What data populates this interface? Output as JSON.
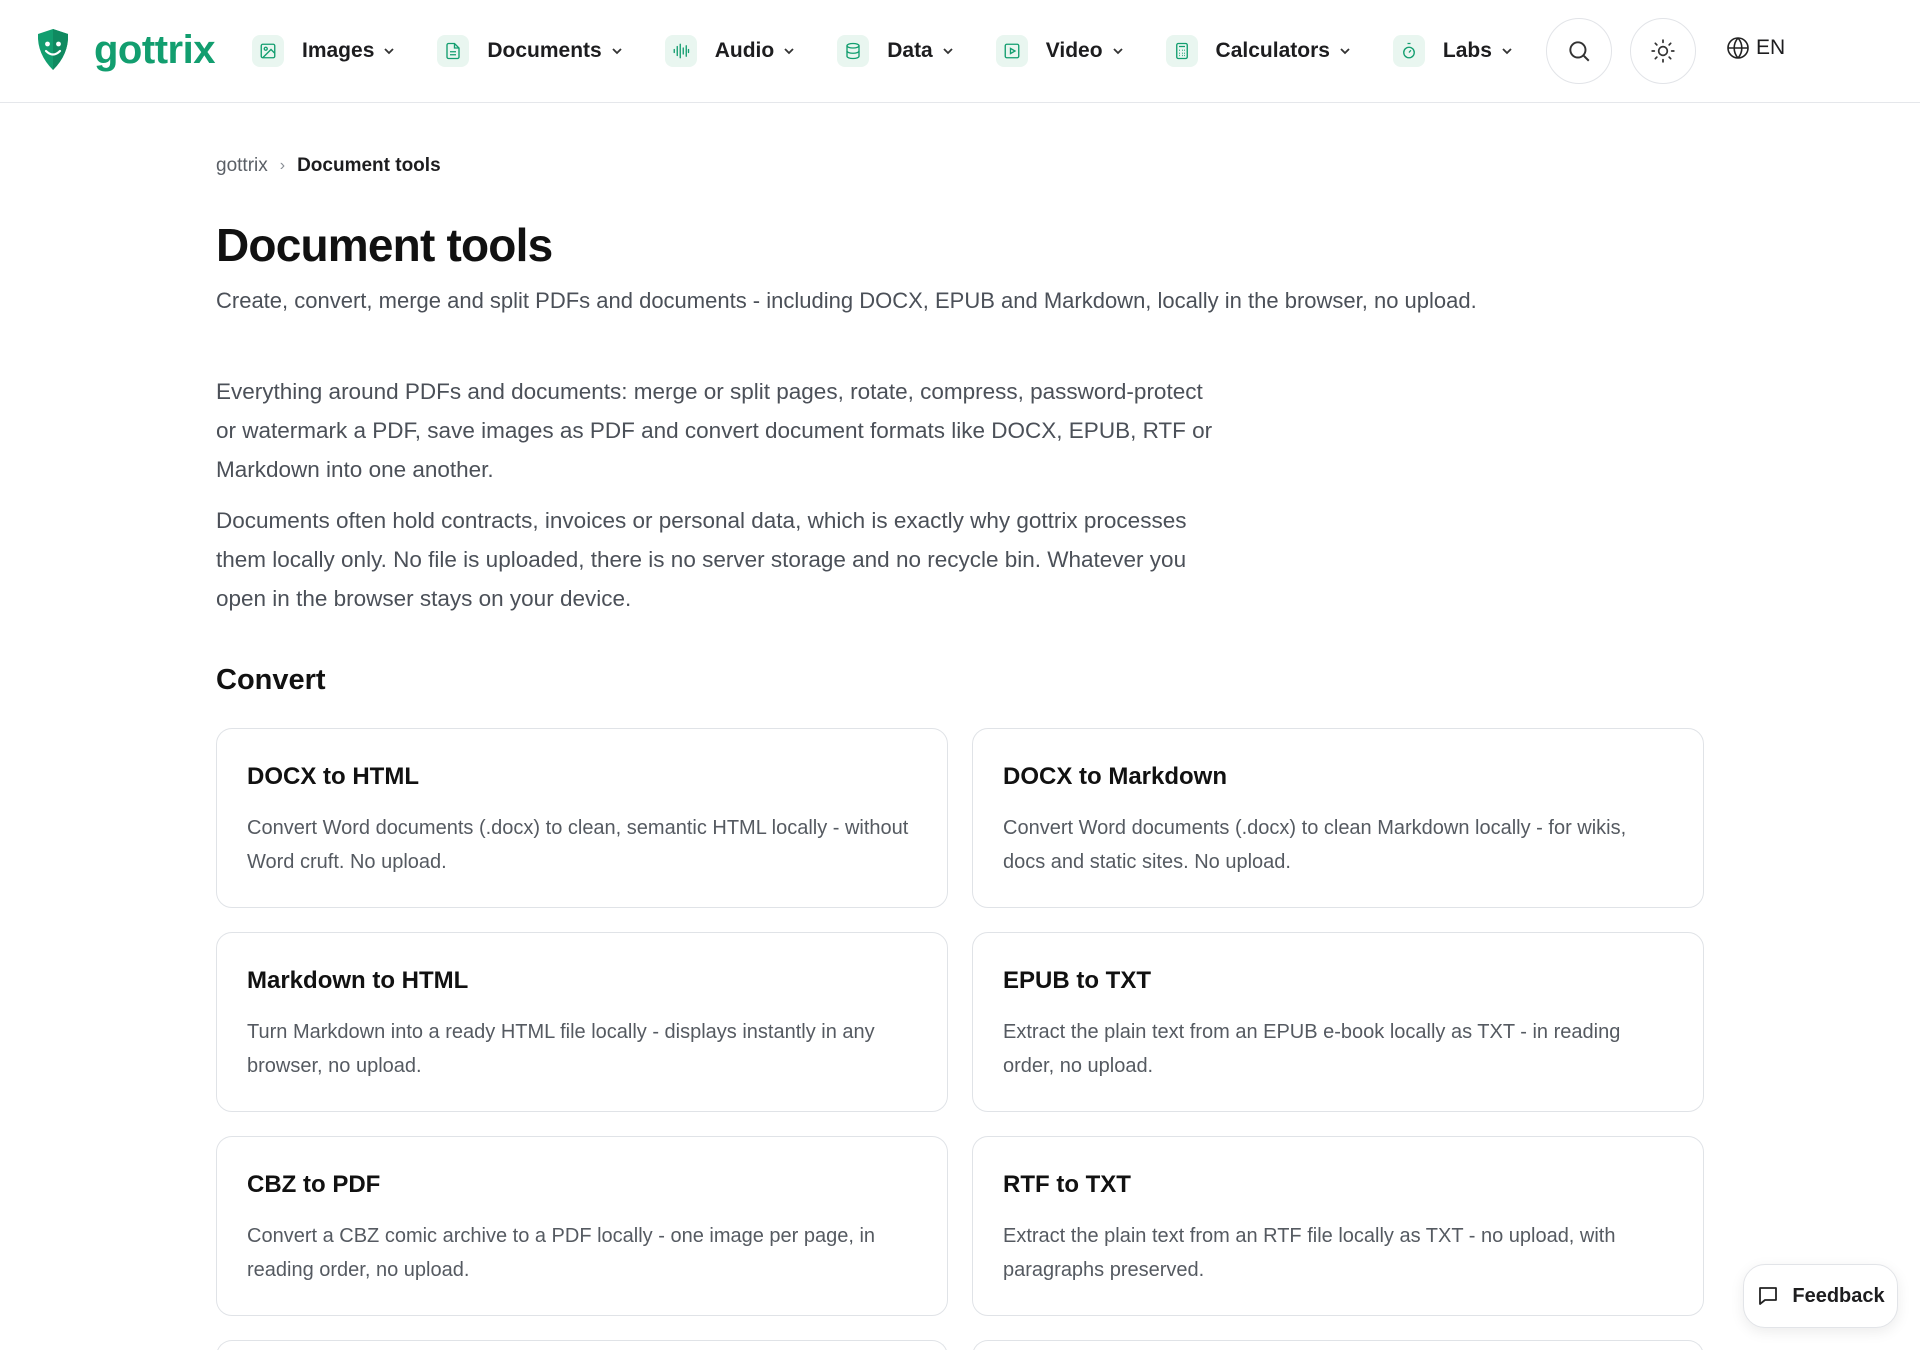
{
  "brand": {
    "name": "gottrix",
    "color": "#129e6f"
  },
  "nav": [
    {
      "label": "Images",
      "icon": "image-icon"
    },
    {
      "label": "Documents",
      "icon": "document-icon"
    },
    {
      "label": "Audio",
      "icon": "audio-waveform-icon"
    },
    {
      "label": "Data",
      "icon": "database-icon"
    },
    {
      "label": "Video",
      "icon": "video-icon"
    },
    {
      "label": "Calculators",
      "icon": "calculator-icon"
    },
    {
      "label": "Labs",
      "icon": "timer-icon"
    }
  ],
  "header": {
    "search_icon": "search-icon",
    "theme_icon": "sun-icon",
    "language": "EN"
  },
  "breadcrumb": {
    "home": "gottrix",
    "current": "Document tools"
  },
  "page": {
    "title": "Document tools",
    "subtitle": "Create, convert, merge and split PDFs and documents - including DOCX, EPUB and Markdown, locally in the browser, no upload.",
    "intro": [
      "Everything around PDFs and documents: merge or split pages, rotate, compress, password-protect or watermark a PDF, save images as PDF and convert document formats like DOCX, EPUB, RTF or Markdown into one another.",
      "Documents often hold contracts, invoices or personal data, which is exactly why gottrix processes them locally only. No file is uploaded, there is no server storage and no recycle bin. Whatever you open in the browser stays on your device."
    ]
  },
  "sections": [
    {
      "title": "Convert",
      "cards": [
        {
          "title": "DOCX to HTML",
          "desc": "Convert Word documents (.docx) to clean, semantic HTML locally - without Word cruft. No upload."
        },
        {
          "title": "DOCX to Markdown",
          "desc": "Convert Word documents (.docx) to clean Markdown locally - for wikis, docs and static sites. No upload."
        },
        {
          "title": "Markdown to HTML",
          "desc": "Turn Markdown into a ready HTML file locally - displays instantly in any browser, no upload."
        },
        {
          "title": "EPUB to TXT",
          "desc": "Extract the plain text from an EPUB e-book locally as TXT - in reading order, no upload."
        },
        {
          "title": "CBZ to PDF",
          "desc": "Convert a CBZ comic archive to a PDF locally - one image per page, in reading order, no upload."
        },
        {
          "title": "RTF to TXT",
          "desc": "Extract the plain text from an RTF file locally as TXT - no upload, with paragraphs preserved."
        }
      ]
    }
  ],
  "feedback": {
    "label": "Feedback",
    "icon": "chat-bubble-icon"
  }
}
